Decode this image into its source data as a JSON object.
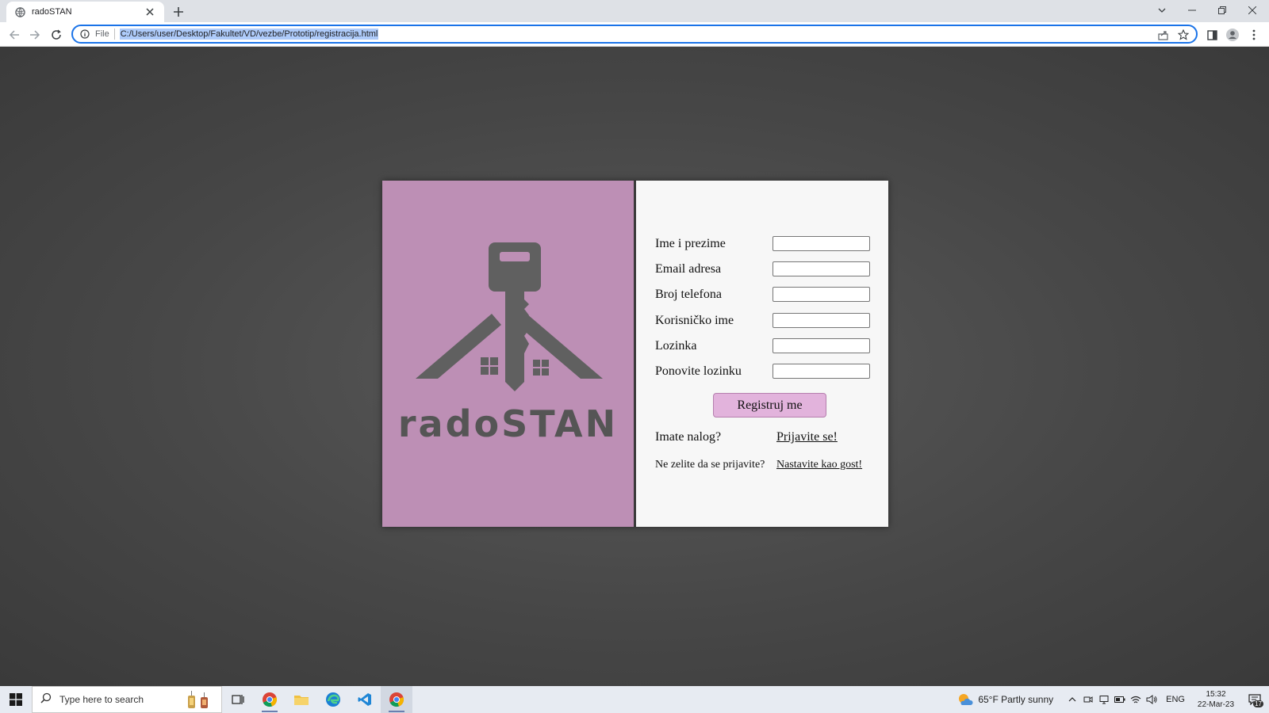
{
  "browser": {
    "tab_title": "radoSTAN",
    "address_prefix": "File",
    "url": "C:/Users/user/Desktop/Fakultet/VD/vezbe/Prototip/registracija.html"
  },
  "brand": {
    "name": "radoSTAN",
    "panel_color": "#bd8fb5"
  },
  "form": {
    "fields": [
      {
        "label": "Ime i prezime",
        "value": ""
      },
      {
        "label": "Email adresa",
        "value": ""
      },
      {
        "label": "Broj telefona",
        "value": ""
      },
      {
        "label": "Korisničko ime",
        "value": ""
      },
      {
        "label": "Lozinka",
        "value": ""
      },
      {
        "label": "Ponovite lozinku",
        "value": ""
      }
    ],
    "submit_label": "Registruj me",
    "login_prompt": "Imate nalog?",
    "login_link": "Prijavite se!",
    "guest_prompt": "Ne zelite da se prijavite?",
    "guest_link": "Nastavite kao gost!",
    "button_color": "#e2b3dc"
  },
  "taskbar": {
    "search_placeholder": "Type here to search",
    "weather": "65°F  Partly sunny",
    "language": "ENG",
    "time": "15:32",
    "date": "22-Mar-23",
    "notification_count": "17"
  }
}
